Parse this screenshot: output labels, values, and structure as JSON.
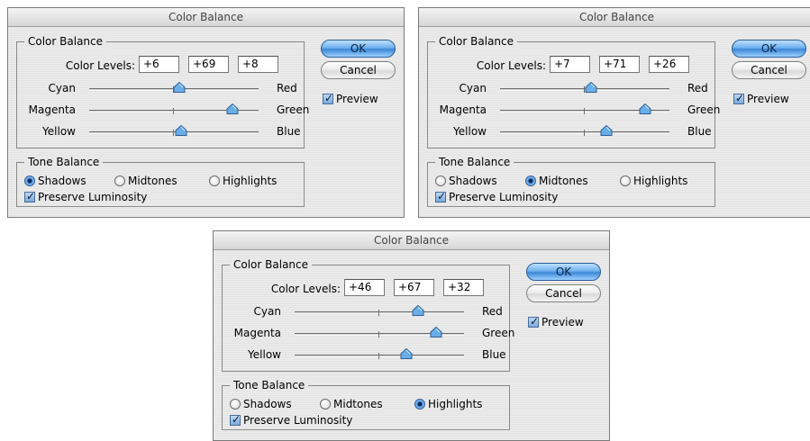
{
  "colors": {
    "thumb": "#6aaee8",
    "ok_button": "#5aa0e6"
  },
  "dialogs": [
    {
      "title": "Color Balance",
      "group_label": "Color Balance",
      "levels_label": "Color Levels:",
      "levels": [
        "+6",
        "+69",
        "+8"
      ],
      "sliders": [
        {
          "left": "Cyan",
          "right": "Red",
          "value": 6
        },
        {
          "left": "Magenta",
          "right": "Green",
          "value": 69
        },
        {
          "left": "Yellow",
          "right": "Blue",
          "value": 8
        }
      ],
      "tone_label": "Tone Balance",
      "tones": [
        "Shadows",
        "Midtones",
        "Highlights"
      ],
      "selected_tone": "Shadows",
      "preserve_label": "Preserve Luminosity",
      "preserve_checked": true,
      "ok_label": "OK",
      "cancel_label": "Cancel",
      "preview_label": "Preview",
      "preview_checked": true
    },
    {
      "title": "Color Balance",
      "group_label": "Color Balance",
      "levels_label": "Color Levels:",
      "levels": [
        "+7",
        "+71",
        "+26"
      ],
      "sliders": [
        {
          "left": "Cyan",
          "right": "Red",
          "value": 7
        },
        {
          "left": "Magenta",
          "right": "Green",
          "value": 71
        },
        {
          "left": "Yellow",
          "right": "Blue",
          "value": 26
        }
      ],
      "tone_label": "Tone Balance",
      "tones": [
        "Shadows",
        "Midtones",
        "Highlights"
      ],
      "selected_tone": "Midtones",
      "preserve_label": "Preserve Luminosity",
      "preserve_checked": true,
      "ok_label": "OK",
      "cancel_label": "Cancel",
      "preview_label": "Preview",
      "preview_checked": true
    },
    {
      "title": "Color Balance",
      "group_label": "Color Balance",
      "levels_label": "Color Levels:",
      "levels": [
        "+46",
        "+67",
        "+32"
      ],
      "sliders": [
        {
          "left": "Cyan",
          "right": "Red",
          "value": 46
        },
        {
          "left": "Magenta",
          "right": "Green",
          "value": 67
        },
        {
          "left": "Yellow",
          "right": "Blue",
          "value": 32
        }
      ],
      "tone_label": "Tone Balance",
      "tones": [
        "Shadows",
        "Midtones",
        "Highlights"
      ],
      "selected_tone": "Highlights",
      "preserve_label": "Preserve Luminosity",
      "preserve_checked": true,
      "ok_label": "OK",
      "cancel_label": "Cancel",
      "preview_label": "Preview",
      "preview_checked": true
    }
  ]
}
